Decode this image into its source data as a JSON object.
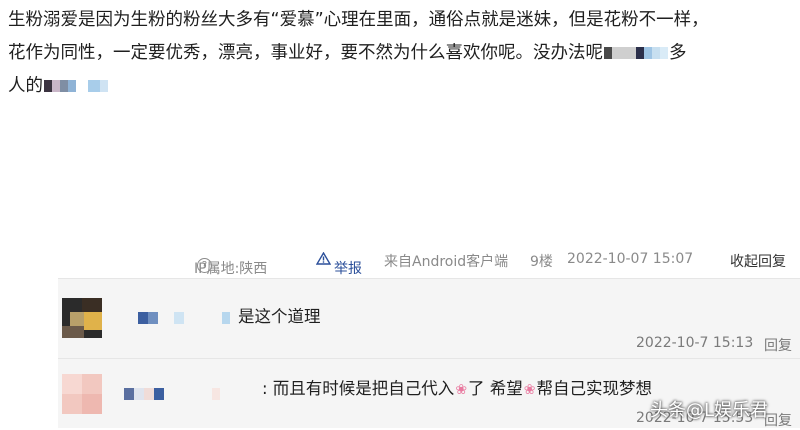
{
  "post": {
    "line1": "生粉溺爱是因为生粉的粉丝大多有“爱慕”心理在里面，通俗点就是迷妹，但是花粉不一样，",
    "line2": "花作为同性，一定要优秀，漂亮，事业好，要不然为什么喜欢你呢。没办法呢",
    "line2_tail": "多",
    "line3": "人的"
  },
  "meta": {
    "ip": "IP属地:陕西",
    "report": "举报",
    "source": "来自Android客户端",
    "floor": "9楼",
    "time": "2022-10-07 15:07",
    "reply_toggle": "收起回复"
  },
  "replies": [
    {
      "text": "是这个道理",
      "time": "2022-10-7 15:13",
      "reply": "回复"
    },
    {
      "text_a": ": 而且有时候是把自己代入",
      "text_b": "了 希望",
      "text_c": "帮自己实现梦想",
      "time": "2022-10-7 15:53",
      "reply": "回复"
    }
  ],
  "watermark": "头条@L娱乐君",
  "colors": {
    "report_link": "#2b4f9a",
    "muted": "#8a8a8a",
    "reply_bg": "#f5f5f5"
  }
}
